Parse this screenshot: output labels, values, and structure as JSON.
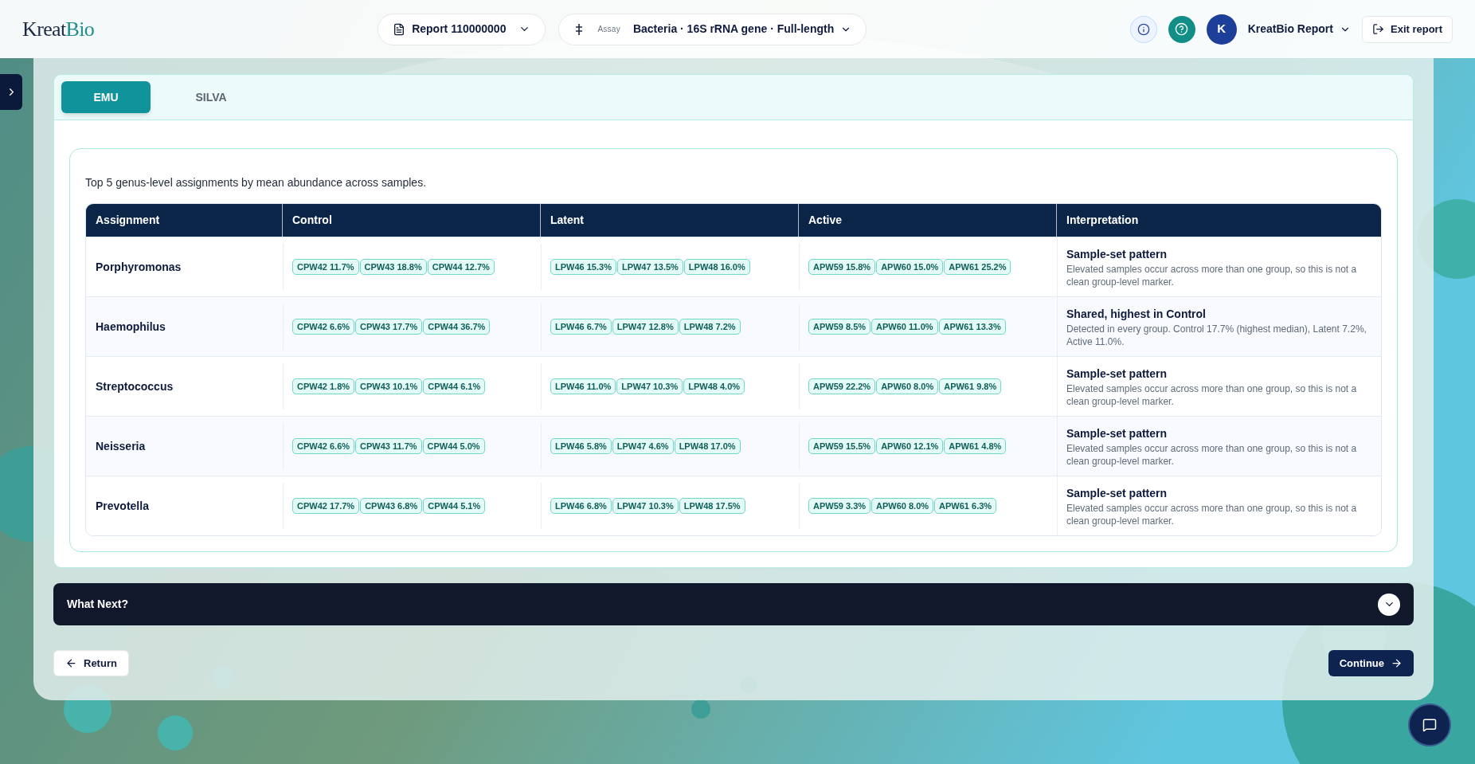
{
  "header": {
    "logo": {
      "part_1": "Kreat",
      "part_2": "Bio"
    },
    "report_select": "Report 110000000",
    "assay_label": "Assay",
    "assay_select": "Bacteria · 16S rRNA gene · Full-length",
    "avatar": "K",
    "account": "KreatBio Report",
    "exit_button": "Exit report"
  },
  "tabs": [
    {
      "label": "EMU",
      "selected": true
    },
    {
      "label": "SILVA",
      "selected": false
    }
  ],
  "caption": "Top 5 genus-level assignments by mean abundance across samples.",
  "table": {
    "columns": [
      "Assignment",
      "Control",
      "Latent",
      "Active",
      "Interpretation"
    ],
    "rows": [
      {
        "assignment": "Porphyromonas",
        "control": [
          "CPW42 11.7%",
          "CPW43 18.8%",
          "CPW44 12.7%"
        ],
        "latent": [
          "LPW46 15.3%",
          "LPW47 13.5%",
          "LPW48 16.0%"
        ],
        "active": [
          "APW59 15.8%",
          "APW60 15.0%",
          "APW61 25.2%"
        ],
        "interpretation_title": "Sample-set pattern",
        "interpretation_text": "Elevated samples occur across more than one group, so this is not a clean group-level marker."
      },
      {
        "assignment": "Haemophilus",
        "control": [
          "CPW42 6.6%",
          "CPW43 17.7%",
          "CPW44 36.7%"
        ],
        "latent": [
          "LPW46 6.7%",
          "LPW47 12.8%",
          "LPW48 7.2%"
        ],
        "active": [
          "APW59 8.5%",
          "APW60 11.0%",
          "APW61 13.3%"
        ],
        "interpretation_title": "Shared, highest in Control",
        "interpretation_text": "Detected in every group. Control 17.7% (highest median), Latent 7.2%, Active 11.0%."
      },
      {
        "assignment": "Streptococcus",
        "control": [
          "CPW42 1.8%",
          "CPW43 10.1%",
          "CPW44 6.1%"
        ],
        "latent": [
          "LPW46 11.0%",
          "LPW47 10.3%",
          "LPW48 4.0%"
        ],
        "active": [
          "APW59 22.2%",
          "APW60 8.0%",
          "APW61 9.8%"
        ],
        "interpretation_title": "Sample-set pattern",
        "interpretation_text": "Elevated samples occur across more than one group, so this is not a clean group-level marker."
      },
      {
        "assignment": "Neisseria",
        "control": [
          "CPW42 6.6%",
          "CPW43 11.7%",
          "CPW44 5.0%"
        ],
        "latent": [
          "LPW46 5.8%",
          "LPW47 4.6%",
          "LPW48 17.0%"
        ],
        "active": [
          "APW59 15.5%",
          "APW60 12.1%",
          "APW61 4.8%"
        ],
        "interpretation_title": "Sample-set pattern",
        "interpretation_text": "Elevated samples occur across more than one group, so this is not a clean group-level marker."
      },
      {
        "assignment": "Prevotella",
        "control": [
          "CPW42 17.7%",
          "CPW43 6.8%",
          "CPW44 5.1%"
        ],
        "latent": [
          "LPW46 6.8%",
          "LPW47 10.3%",
          "LPW48 17.5%"
        ],
        "active": [
          "APW59 3.3%",
          "APW60 8.0%",
          "APW61 6.3%"
        ],
        "interpretation_title": "Sample-set pattern",
        "interpretation_text": "Elevated samples occur across more than one group, so this is not a clean group-level marker."
      }
    ]
  },
  "what_next": {
    "title": "What Next?",
    "expanded": false
  },
  "buttons": {
    "return": "Return",
    "continue": "Continue"
  }
}
